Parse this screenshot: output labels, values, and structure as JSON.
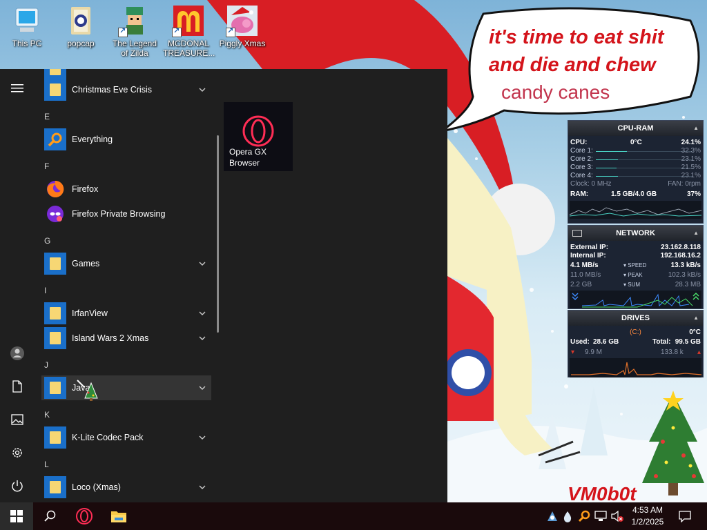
{
  "desktop": {
    "icons": [
      {
        "label": "This PC",
        "icon": "computer-icon"
      },
      {
        "label": "popcap",
        "icon": "folder-popcap-icon"
      },
      {
        "label": "The Legend of Zilda",
        "icon": "game-shortcut-icon"
      },
      {
        "label": "MCDONAL TREASURE...",
        "icon": "mcdonalds-shortcut-icon"
      },
      {
        "label": "Piggly Xmas",
        "icon": "piggly-shortcut-icon"
      }
    ],
    "speech": {
      "line1": "it's time to eat shit",
      "line2": "and die and chew",
      "line3": "candy canes"
    },
    "watermark": "VM0b0t"
  },
  "start_menu": {
    "rail": [
      "hamburger-menu-icon",
      "user-avatar-icon",
      "documents-icon",
      "pictures-icon",
      "settings-icon",
      "power-icon"
    ],
    "apps": [
      {
        "type": "app",
        "name": "Christmas Eve Crisis",
        "icon": "folder",
        "expand": true
      },
      {
        "type": "letter",
        "name": "E"
      },
      {
        "type": "app",
        "name": "Everything",
        "icon": "everything",
        "expand": false
      },
      {
        "type": "letter",
        "name": "F"
      },
      {
        "type": "app",
        "name": "Firefox",
        "icon": "firefox",
        "expand": false
      },
      {
        "type": "app",
        "name": "Firefox Private Browsing",
        "icon": "firefox-private",
        "expand": false
      },
      {
        "type": "letter",
        "name": "G"
      },
      {
        "type": "app",
        "name": "Games",
        "icon": "folder",
        "expand": true
      },
      {
        "type": "letter",
        "name": "I"
      },
      {
        "type": "app",
        "name": "IrfanView",
        "icon": "folder",
        "expand": true
      },
      {
        "type": "app",
        "name": "Island Wars 2 Xmas",
        "icon": "folder",
        "expand": true
      },
      {
        "type": "letter",
        "name": "J"
      },
      {
        "type": "app",
        "name": "Java",
        "icon": "folder",
        "expand": true,
        "hover": true
      },
      {
        "type": "letter",
        "name": "K"
      },
      {
        "type": "app",
        "name": "K-Lite Codec Pack",
        "icon": "folder",
        "expand": true
      },
      {
        "type": "letter",
        "name": "L"
      },
      {
        "type": "app",
        "name": "Loco (Xmas)",
        "icon": "folder",
        "expand": true
      }
    ],
    "tile": {
      "name": "Opera GX Browser",
      "icon": "opera-gx-icon"
    }
  },
  "widgets": {
    "cpu": {
      "title": "CPU-RAM",
      "cpu_label": "CPU:",
      "temp": "0°C",
      "cpu_pct": "24.1%",
      "cores": [
        {
          "label": "Core 1:",
          "value": "32.3%",
          "level": 0.323
        },
        {
          "label": "Core 2:",
          "value": "23.1%",
          "level": 0.231
        },
        {
          "label": "Core 3:",
          "value": "21.5%",
          "level": 0.215
        },
        {
          "label": "Core 4:",
          "value": "23.1%",
          "level": 0.231
        }
      ],
      "clock": "Clock: 0 MHz",
      "fan": "FAN: 0rpm",
      "ram_label": "RAM:",
      "ram_value": "1.5 GB/4.0 GB",
      "ram_pct": "37%"
    },
    "network": {
      "title": "NETWORK",
      "external_label": "External IP:",
      "external_ip": "23.162.8.118",
      "internal_label": "Internal IP:",
      "internal_ip": "192.168.16.2",
      "speed_down": "4.1 MB/s",
      "speed_label": "SPEED",
      "speed_up": "13.3 kB/s",
      "peak_down": "11.0 MB/s",
      "peak_label": "PEAK",
      "peak_up": "102.3 kB/s",
      "sum_down": "2.2 GB",
      "sum_label": "SUM",
      "sum_up": "28.3 MB"
    },
    "drives": {
      "title": "DRIVES",
      "temp": "0°C",
      "drive": "(C:)",
      "used_label": "Used:",
      "used": "28.6 GB",
      "total_label": "Total:",
      "total": "99.5 GB",
      "read": "9.9 M",
      "write": "133.8 k"
    }
  },
  "taskbar": {
    "buttons": [
      "windows-start-icon",
      "search-icon",
      "opera-gx-icon",
      "file-explorer-icon"
    ],
    "tray": [
      "user-network-icon",
      "droplet-icon",
      "everything-tray-icon",
      "network-icon",
      "volume-muted-icon"
    ],
    "time": "4:53 AM",
    "date": "1/2/2025"
  },
  "colors": {
    "menu_bg": "#1f1f1f",
    "folder_blue": "#1a6fc9",
    "taskbar": "#1a0a0c",
    "accent_red": "#d4141b"
  }
}
